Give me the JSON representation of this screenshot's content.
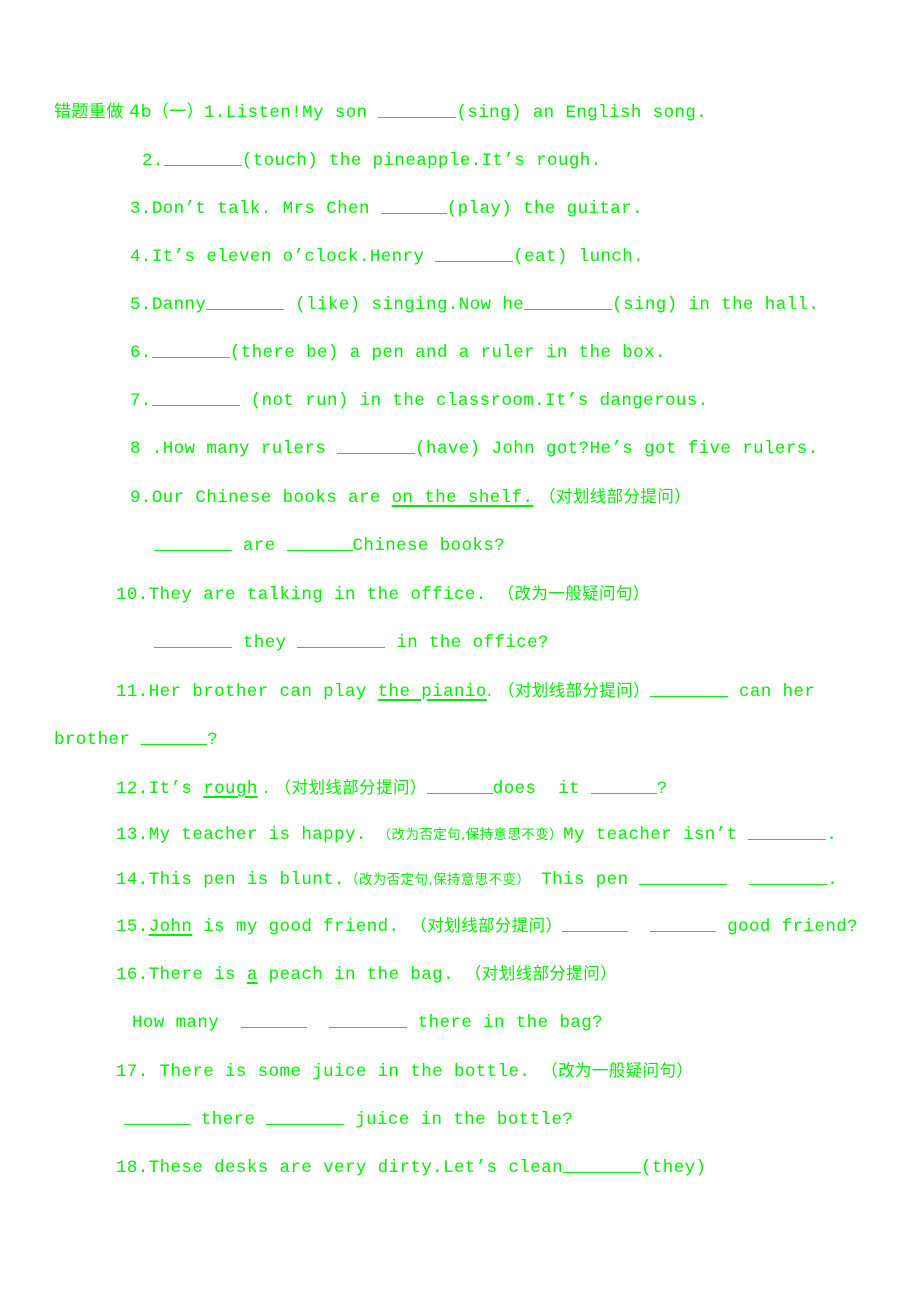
{
  "document": {
    "title": "错题重做 4b（一）",
    "text_color": "#00ee00",
    "background_color": "#ffffff",
    "heading": {
      "cn_title": "错题重做 4b（一）"
    },
    "instructions": {
      "underline_question": "（对划线部分提问）",
      "general_question": "（改为一般疑问句）",
      "negative_keep_meaning": "（改为否定句,保持意思不变）"
    },
    "items": [
      {
        "number": "1.",
        "pre": "Listen!My son ",
        "post": "(sing) an English song."
      },
      {
        "number": "2.",
        "pre": "",
        "post": "(touch) the pineapple.It’s rough."
      },
      {
        "number": "3.",
        "pre": "Don’t talk. Mrs Chen ",
        "post": "(play) the guitar."
      },
      {
        "number": "4.",
        "pre": "It’s eleven o’clock.Henry ",
        "post": "(eat) lunch."
      },
      {
        "number": "5.",
        "pre": "Danny",
        "mid": " (like) singing.Now he",
        "post": "(sing) in the hall."
      },
      {
        "number": "6.",
        "pre": "",
        "post": "(there be) a pen and a ruler in the box."
      },
      {
        "number": "7.",
        "pre": "",
        "post": " (not run) in the classroom.It’s dangerous."
      },
      {
        "number": "8 .",
        "pre": "How many rulers ",
        "post": "(have) John got?He’s got five rulers."
      },
      {
        "number": "9.",
        "pre": "Our Chinese books are ",
        "underlined": "on the shelf.",
        "post": " （对划线部分提问）",
        "answer_pre": " ",
        "answer_mid": " are ",
        "answer_post": "Chinese books?"
      },
      {
        "number": "10.",
        "pre": "They are talking in the office. ",
        "post": "（改为一般疑问句）",
        "answer_pre": " ",
        "answer_mid": " they ",
        "answer_post": " in the office?"
      },
      {
        "number": "11.",
        "pre": "Her brother can play ",
        "underlined": "the pianio",
        "post": ". （对划线部分提问）",
        "answer_mid": " can her",
        "answer_wrap_pre": "brother ",
        "answer_wrap_post": "?"
      },
      {
        "number": "12.",
        "pre": "It’s ",
        "underlined": "rough",
        "post": " . （对划线部分提问）",
        "answer_mid": "does  it ",
        "answer_post": "?"
      },
      {
        "number": "13.",
        "pre": "My teacher is happy. ",
        "cn": "（改为否定句,保持意思不变）",
        "answer_pre": "My teacher isn’t ",
        "answer_post": "."
      },
      {
        "number": "14.",
        "pre": "This pen is blunt.",
        "cn": "（改为否定句,保持意思不变）",
        "answer_pre": " This pen ",
        "answer_post": "."
      },
      {
        "number": "15.",
        "pre": "",
        "underlined": "John",
        "mid": " is my good friend. ",
        "post": "（对划线部分提问）",
        "answer_post": " good friend?"
      },
      {
        "number": "16.",
        "pre": "There is ",
        "underlined": "a",
        "mid": " peach in the bag. ",
        "post": "（对划线部分提问）",
        "answer_pre": "How many  ",
        "answer_post": " there in the bag?"
      },
      {
        "number": "17.",
        "pre": " There is some juice in the bottle. ",
        "post": "（改为一般疑问句）",
        "answer_mid": " there ",
        "answer_post": " juice in the bottle?"
      },
      {
        "number": "18.",
        "pre": "These desks are very dirty.Let’s clean",
        "post": "(they)"
      }
    ]
  }
}
